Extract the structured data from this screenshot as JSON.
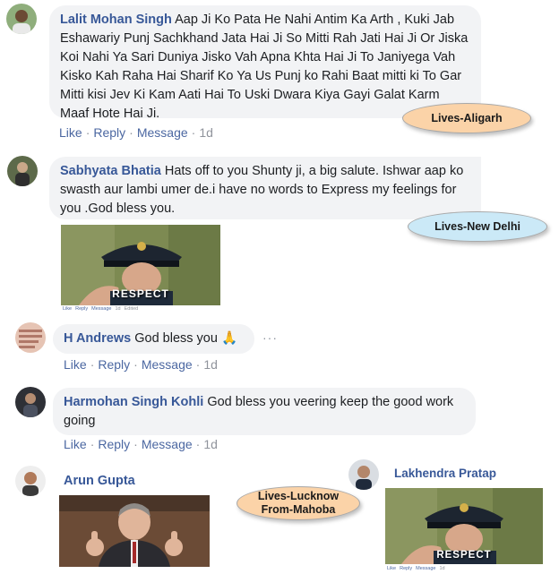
{
  "comments": [
    {
      "author": "Lalit Mohan Singh",
      "text": "Aap Ji Ko Pata He Nahi Antim Ka Arth , Kuki Jab Eshawariy Punj Sachkhand Jata Hai Ji So Mitti Rah Jati Hai Ji Or Jiska Koi Nahi Ya Sari Duniya Jisko Vah Apna Khta Hai Ji To Janiyega Vah Kisko Kah Raha Hai Sharif Ko Ya Us Punj ko Rahi Baat mitti ki To Gar Mitti kisi Jev Ki Kam Aati Hai To Uski Dwara Kiya Gayi Galat Karm Maaf Hote Hai Ji.",
      "actions": {
        "like": "Like",
        "reply": "Reply",
        "message": "Message",
        "time": "1d"
      }
    },
    {
      "author": "Sabhyata Bhatia",
      "text": "Hats off to you Shunty ji, a big salute. Ishwar aap ko swasth aur lambi umer de.i have no words to Express my feelings for you .God bless you.",
      "gif_caption": "RESPECT",
      "tiny_actions": {
        "like": "Like",
        "reply": "Reply",
        "message": "Message",
        "time": "1d",
        "edited": "Edited"
      }
    },
    {
      "author": "H Andrews",
      "text": "God bless you 🙏",
      "more": "···",
      "actions": {
        "like": "Like",
        "reply": "Reply",
        "message": "Message",
        "time": "1d"
      }
    },
    {
      "author": "Harmohan Singh Kohli",
      "text": "God bless you veering keep the good work going",
      "actions": {
        "like": "Like",
        "reply": "Reply",
        "message": "Message",
        "time": "1d"
      }
    },
    {
      "author": "Arun Gupta"
    },
    {
      "author": "Lakhendra Pratap",
      "gif_caption": "RESPECT",
      "tiny_actions": {
        "like": "Like",
        "reply": "Reply",
        "message": "Message",
        "time": "1d"
      }
    }
  ],
  "tags": {
    "aligarh": "Lives-Aligarh",
    "new_delhi": "Lives-New Delhi",
    "lucknow_line1": "Lives-Lucknow",
    "lucknow_line2": "From-Mahoba"
  },
  "colors": {
    "author": "#385898",
    "bubble": "#f2f3f5",
    "tag_orange": "#fbd3a8",
    "tag_blue": "#cbe9f7",
    "action_link": "#4b67a1"
  }
}
